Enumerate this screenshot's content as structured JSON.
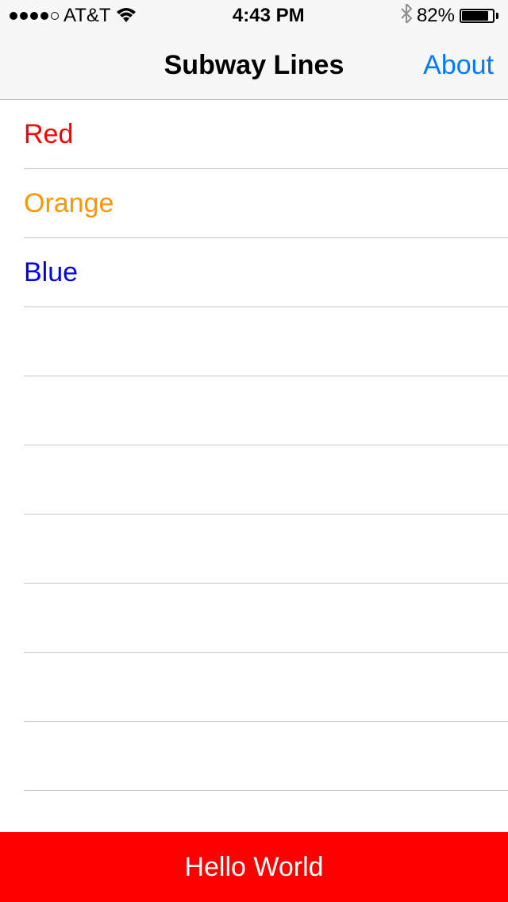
{
  "status_bar": {
    "carrier": "AT&T",
    "time": "4:43 PM",
    "battery_pct": "82%"
  },
  "nav": {
    "title": "Subway Lines",
    "right_button": "About"
  },
  "lines": [
    {
      "label": "Red",
      "color": "#ff0000"
    },
    {
      "label": "Orange",
      "color": "#ff9500"
    },
    {
      "label": "Blue",
      "color": "#0000ff"
    }
  ],
  "footer": {
    "label": "Hello World",
    "background": "#ff0000"
  }
}
